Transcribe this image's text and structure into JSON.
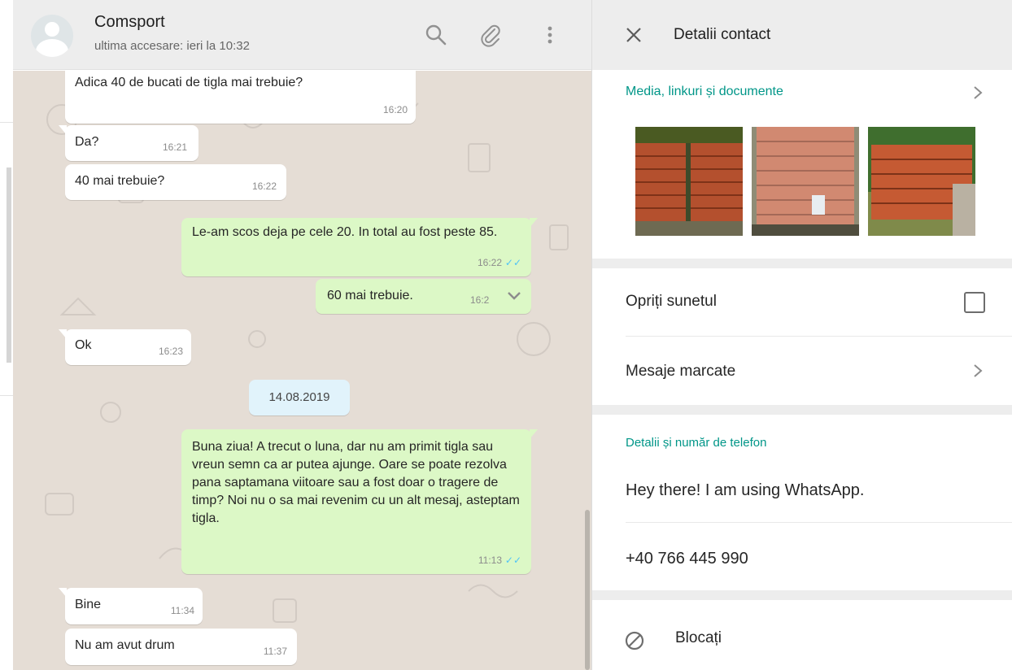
{
  "chat": {
    "contact_name": "Comsport",
    "last_seen": "ultima accesare: ieri la 10:32",
    "messages": [
      {
        "dir": "in",
        "text": "Adica 40 de bucati de tigla mai trebuie?",
        "time": "16:20"
      },
      {
        "dir": "in",
        "text": "Da?",
        "time": "16:21"
      },
      {
        "dir": "in",
        "text": "40 mai trebuie?",
        "time": "16:22"
      },
      {
        "dir": "out",
        "text": "Le-am scos deja pe cele 20. In total au fost peste 85.",
        "time": "16:22"
      },
      {
        "dir": "out",
        "text": "60 mai trebuie.",
        "time": "16:2"
      },
      {
        "dir": "in",
        "text": "Ok",
        "time": "16:23"
      },
      {
        "dir": "out",
        "text": "Buna ziua! A trecut o luna, dar nu am primit tigla sau vreun semn ca ar putea ajunge. Oare se poate rezolva pana saptamana viitoare sau a fost doar o tragere de timp? Noi nu o sa mai revenim cu un alt mesaj, asteptam tigla.",
        "time": "11:13"
      },
      {
        "dir": "in",
        "text": "Bine",
        "time": "11:34"
      },
      {
        "dir": "in",
        "text": "Nu am avut drum",
        "time": "11:37"
      }
    ],
    "date_separator": "14.08.2019",
    "icons": [
      "search-icon",
      "attach-icon",
      "menu-icon",
      "chevron-down-icon",
      "double-check-icon"
    ]
  },
  "panel": {
    "title": "Detalii contact",
    "media_title": "Media, linkuri și documente",
    "media_thumbs": [
      "photo-roof-tiles-1",
      "photo-roof-tiles-2",
      "photo-roof-tiles-3"
    ],
    "mute_label": "Opriți sunetul",
    "mute_checked": false,
    "starred_label": "Mesaje marcate",
    "details_title": "Detalii și număr de telefon",
    "about": "Hey there! I am using WhatsApp.",
    "phone": "+40 766 445 990",
    "block_label": "Blocați",
    "colors": {
      "accent": "#009688",
      "outgoing": "#dcf8c6",
      "incoming": "#ffffff",
      "chat_bg": "#e5ddd5",
      "read_ticks": "#4fc3f7"
    }
  }
}
